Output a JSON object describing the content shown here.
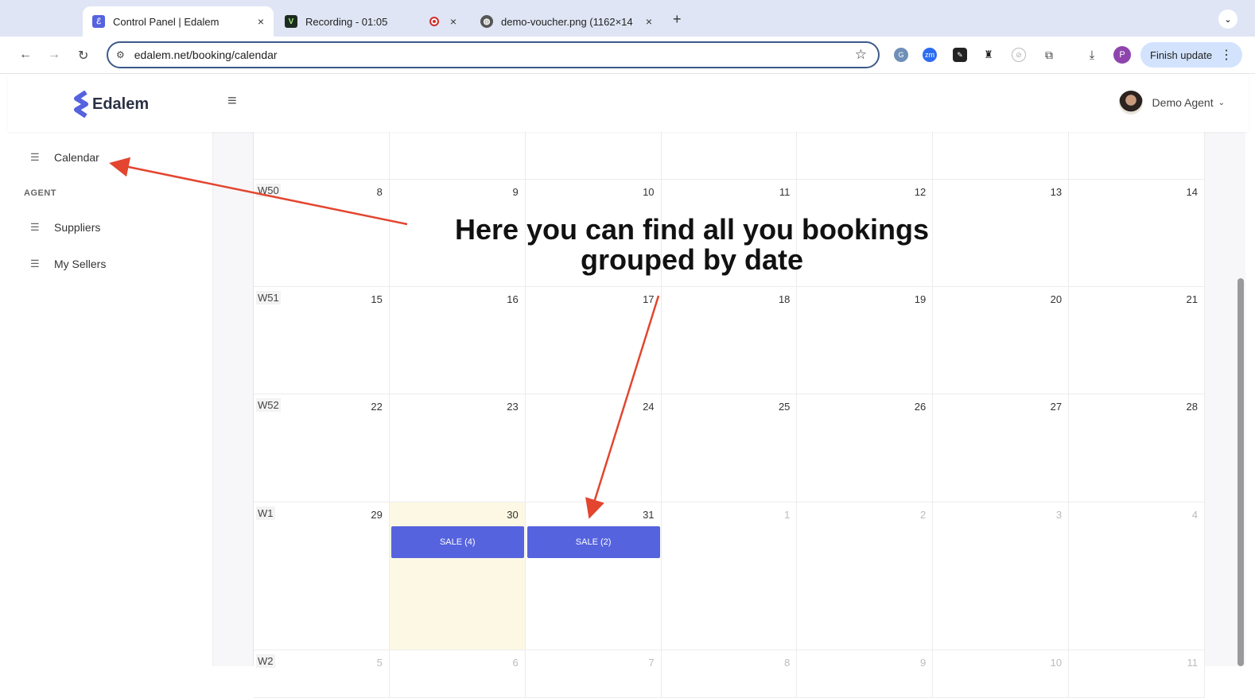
{
  "browser": {
    "tabs": [
      {
        "title": "Control Panel | Edalem",
        "close": "×"
      },
      {
        "title": "Recording - 01:05",
        "close": "×"
      },
      {
        "title": "demo-voucher.png (1162×14",
        "close": "×"
      }
    ],
    "new_tab": "+",
    "url": "edalem.net/booking/calendar",
    "profile_initial": "P",
    "finish_update": "Finish update",
    "ext_zm": "zm",
    "colors": {
      "accent": "#3c5a8a",
      "tab_bg": "#dfe5f4"
    }
  },
  "app": {
    "logo_text": "Edalem",
    "user_name": "Demo Agent",
    "brand_color": "#5563de"
  },
  "sidebar": {
    "calendar_label": "Calendar",
    "section_agent": "AGENT",
    "suppliers_label": "Suppliers",
    "sellers_label": "My Sellers"
  },
  "calendar": {
    "weeks": [
      {
        "label": "",
        "days": [
          "",
          "",
          "",
          "",
          "",
          "",
          ""
        ]
      },
      {
        "label": "W50",
        "days": [
          "8",
          "9",
          "10",
          "11",
          "12",
          "13",
          "14"
        ]
      },
      {
        "label": "W51",
        "days": [
          "15",
          "16",
          "17",
          "18",
          "19",
          "20",
          "21"
        ]
      },
      {
        "label": "W52",
        "days": [
          "22",
          "23",
          "24",
          "25",
          "26",
          "27",
          "28"
        ]
      },
      {
        "label": "W1",
        "days": [
          "29",
          "30",
          "31",
          "1",
          "2",
          "3",
          "4"
        ]
      },
      {
        "label": "W2",
        "days": [
          "5",
          "6",
          "7",
          "8",
          "9",
          "10",
          "11"
        ]
      }
    ],
    "events": [
      {
        "label": "SALE (4)"
      },
      {
        "label": "SALE (2)"
      }
    ]
  },
  "annotation": {
    "line1": "Here you can find all you bookings",
    "line2": "grouped by date",
    "arrow_color": "#e3452f"
  }
}
